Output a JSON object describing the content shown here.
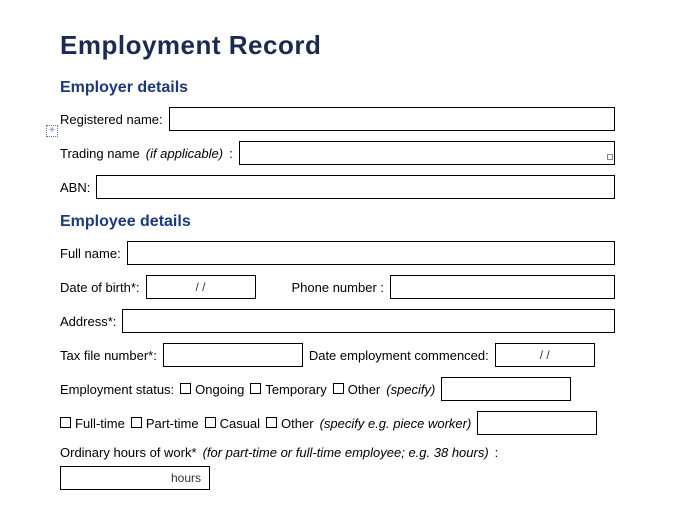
{
  "title": "Employment Record",
  "employer": {
    "heading": "Employer details",
    "registered_name_label": "Registered name:",
    "trading_name_label": "Trading name",
    "trading_name_note": "(if applicable)",
    "trading_name_colon": ":",
    "abn_label": "ABN:"
  },
  "employee": {
    "heading": "Employee details",
    "full_name_label": "Full name:",
    "dob_label": "Date of birth*:",
    "dob_placeholder": "/         /",
    "phone_label": "Phone number  :",
    "address_label": "Address*:",
    "tfn_label": "Tax file number*:",
    "commenced_label": "Date employment commenced:",
    "commenced_placeholder": "/         /",
    "status_label": "Employment status:",
    "status_ongoing": "Ongoing",
    "status_temporary": "Temporary",
    "status_other": "Other",
    "status_other_note": "(specify)",
    "type_fulltime": "Full-time",
    "type_parttime": "Part-time",
    "type_casual": "Casual",
    "type_other": "Other",
    "type_other_note": "(specify e.g. piece worker)",
    "hours_label": "Ordinary hours of work*",
    "hours_note": "(for part-time or full-time employee; e.g. 38 hours)",
    "hours_colon": ":",
    "hours_suffix": "hours"
  },
  "anchor_glyph": "+"
}
